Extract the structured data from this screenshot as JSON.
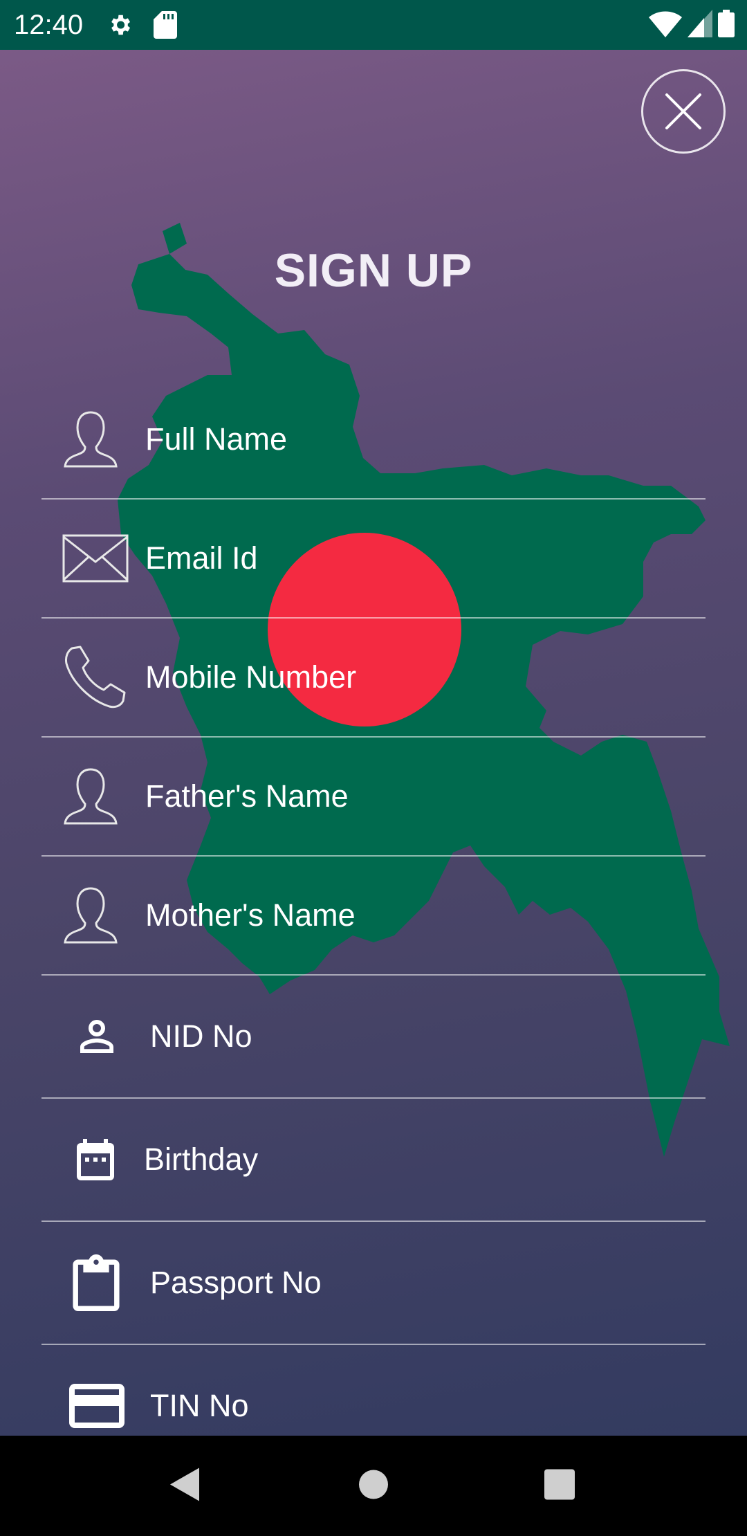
{
  "status_bar": {
    "time": "12:40",
    "icons": [
      "settings-icon",
      "sd-card-icon",
      "wifi-icon",
      "signal-icon",
      "battery-icon"
    ]
  },
  "screen": {
    "title": "SIGN UP",
    "close_icon": "close-icon",
    "fields": [
      {
        "label": "Full Name",
        "icon": "person-outline-icon"
      },
      {
        "label": "Email Id",
        "icon": "envelope-icon"
      },
      {
        "label": "Mobile Number",
        "icon": "phone-icon"
      },
      {
        "label": "Father's Name",
        "icon": "person-outline-icon"
      },
      {
        "label": "Mother's Name",
        "icon": "person-outline-icon"
      },
      {
        "label": "NID No",
        "icon": "person-icon"
      },
      {
        "label": "Birthday",
        "icon": "calendar-icon"
      },
      {
        "label": "Passport No",
        "icon": "clipboard-icon"
      },
      {
        "label": "TIN No",
        "icon": "credit-card-icon"
      }
    ]
  },
  "nav_bar": {
    "icons": [
      "back-icon",
      "home-icon",
      "recents-icon"
    ]
  },
  "colors": {
    "status_bar": "#00574b",
    "map_green": "#006a4e",
    "flag_red": "#f42a41",
    "gradient_top": "#7b5a86",
    "gradient_bottom": "#333b60"
  }
}
